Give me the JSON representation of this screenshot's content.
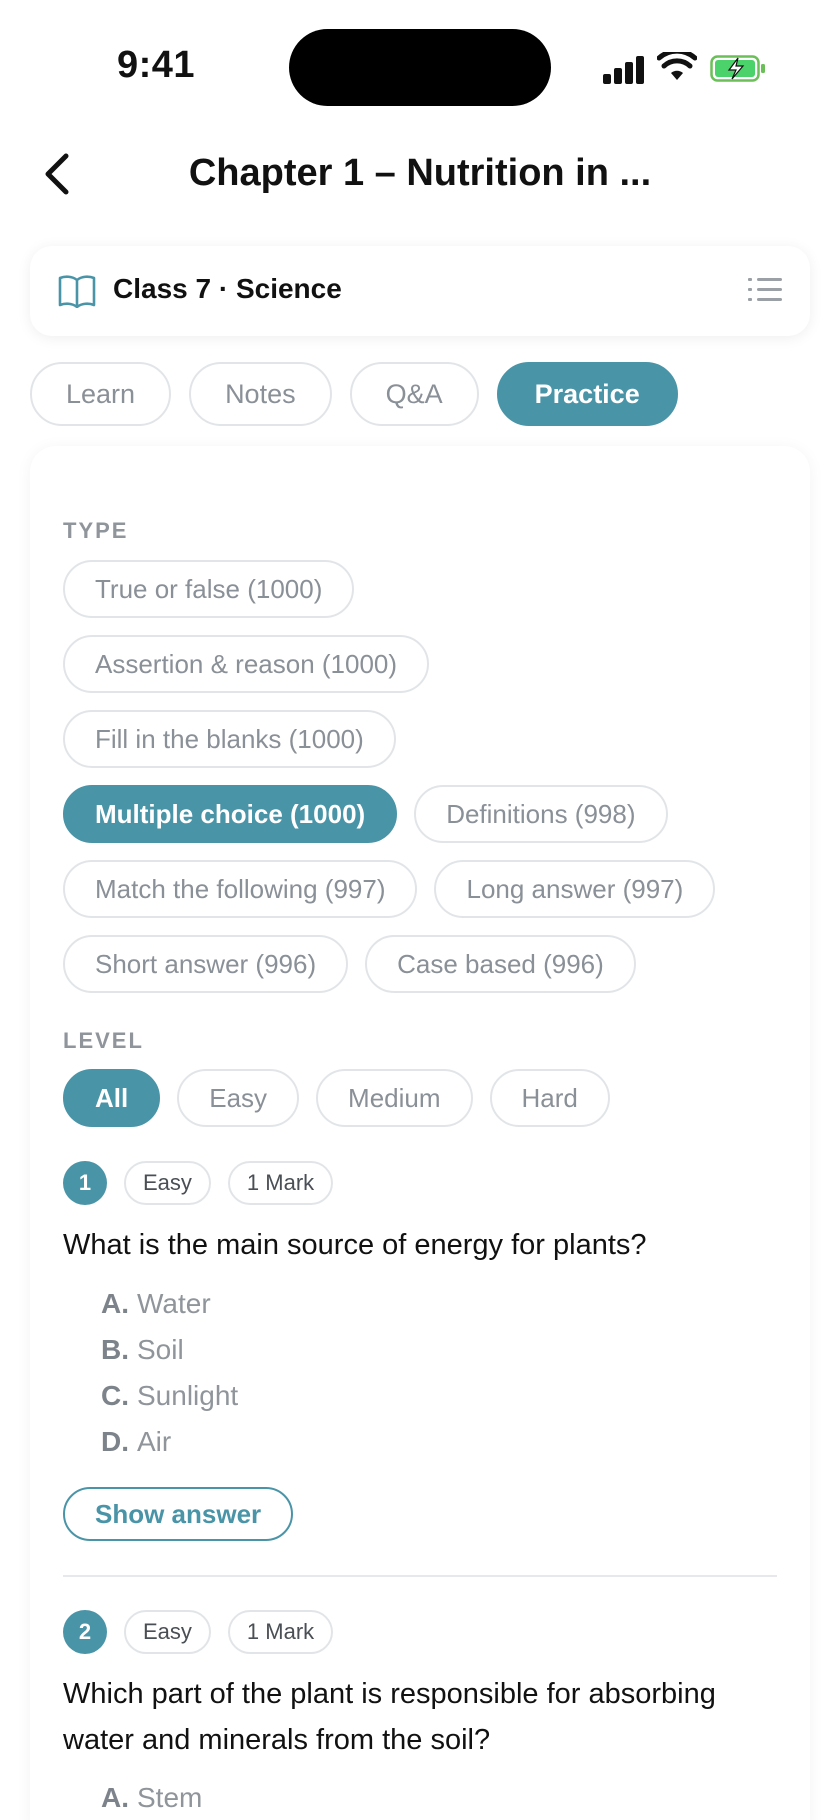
{
  "status": {
    "time": "9:41",
    "icons": [
      "signal-icon",
      "wifi-icon",
      "battery-charging-icon"
    ]
  },
  "header": {
    "title": "Chapter 1 – Nutrition in ...",
    "back_icon": "chevron-left-icon"
  },
  "subject": {
    "label": "Class 7 · Science",
    "icon": "book-icon",
    "menu_icon": "list-icon"
  },
  "tabs": [
    {
      "label": "Learn",
      "active": false
    },
    {
      "label": "Notes",
      "active": false
    },
    {
      "label": "Q&A",
      "active": false
    },
    {
      "label": "Practice",
      "active": true
    }
  ],
  "type_filter": {
    "label": "TYPE",
    "options": [
      {
        "label": "True or false (1000)",
        "active": false
      },
      {
        "label": "Assertion & reason (1000)",
        "active": false
      },
      {
        "label": "Fill in the blanks (1000)",
        "active": false
      },
      {
        "label": "Multiple choice (1000)",
        "active": true
      },
      {
        "label": "Definitions (998)",
        "active": false
      },
      {
        "label": "Match the following (997)",
        "active": false
      },
      {
        "label": "Long answer (997)",
        "active": false
      },
      {
        "label": "Short answer (996)",
        "active": false
      },
      {
        "label": "Case based (996)",
        "active": false
      }
    ]
  },
  "level_filter": {
    "label": "LEVEL",
    "options": [
      {
        "label": "All",
        "active": true
      },
      {
        "label": "Easy",
        "active": false
      },
      {
        "label": "Medium",
        "active": false
      },
      {
        "label": "Hard",
        "active": false
      }
    ]
  },
  "questions": [
    {
      "number": "1",
      "level": "Easy",
      "marks": "1 Mark",
      "text": "What is the main source of energy for plants?",
      "options": [
        {
          "letter": "A.",
          "text": "Water"
        },
        {
          "letter": "B.",
          "text": "Soil"
        },
        {
          "letter": "C.",
          "text": "Sunlight"
        },
        {
          "letter": "D.",
          "text": "Air"
        }
      ],
      "show_answer_label": "Show answer"
    },
    {
      "number": "2",
      "level": "Easy",
      "marks": "1 Mark",
      "text": "Which part of the plant is responsible for absorbing water and minerals from the soil?",
      "options": [
        {
          "letter": "A.",
          "text": "Stem"
        }
      ]
    }
  ],
  "colors": {
    "accent": "#4a94a8",
    "chip_border": "#e2e5e8",
    "muted_text": "#8a9097"
  }
}
